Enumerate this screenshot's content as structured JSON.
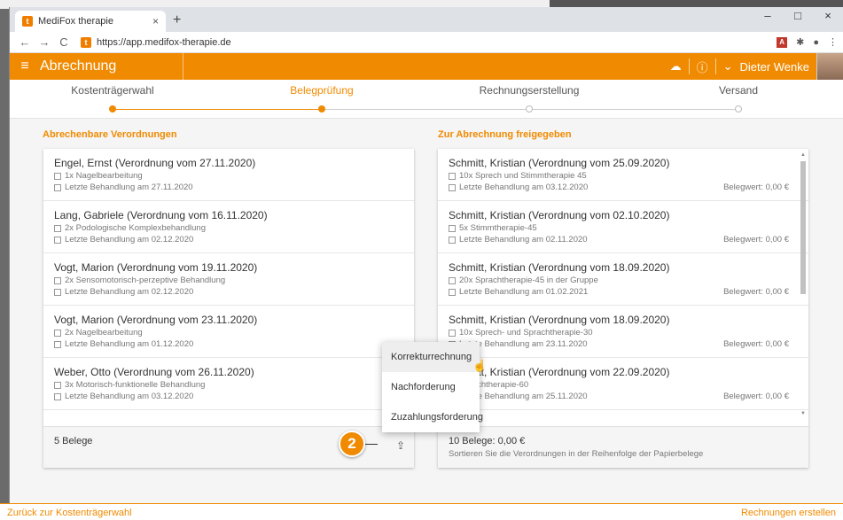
{
  "browser": {
    "tab_title": "MediFox therapie",
    "tab_close": "×",
    "new_tab": "+",
    "url": "https://app.medifox-therapie.de",
    "win_min": "–",
    "win_max": "□",
    "win_close": "×"
  },
  "app": {
    "title": "Abrechnung",
    "user": "Dieter Wenke",
    "accent": "#f08a00"
  },
  "steps": [
    {
      "label": "Kostenträgerwahl"
    },
    {
      "label": "Belegprüfung"
    },
    {
      "label": "Rechnungserstellung"
    },
    {
      "label": "Versand"
    }
  ],
  "left": {
    "title": "Abrechenbare Verordnungen",
    "items": [
      {
        "title": "Engel, Ernst (Verordnung vom 27.11.2020)",
        "line1": "1x Nagelbearbeitung",
        "line2": "Letzte Behandlung am 27.11.2020"
      },
      {
        "title": "Lang, Gabriele (Verordnung vom 16.11.2020)",
        "line1": "2x Podologische Komplexbehandlung",
        "line2": "Letzte Behandlung am 02.12.2020"
      },
      {
        "title": "Vogt, Marion (Verordnung vom 19.11.2020)",
        "line1": "2x Sensomotorisch-perzeptive Behandlung",
        "line2": "Letzte Behandlung am 02.12.2020"
      },
      {
        "title": "Vogt, Marion (Verordnung vom 23.11.2020)",
        "line1": "2x Nagelbearbeitung",
        "line2": "Letzte Behandlung am 01.12.2020"
      },
      {
        "title": "Weber, Otto (Verordnung vom 26.11.2020)",
        "line1": "3x Motorisch-funktionelle Behandlung",
        "line2": "Letzte Behandlung am 03.12.2020"
      }
    ],
    "footer": "5 Belege"
  },
  "right": {
    "title": "Zur Abrechnung freigegeben",
    "items": [
      {
        "title": "Schmitt, Kristian (Verordnung vom 25.09.2020)",
        "line1": "10x Sprech  und Stimmtherapie 45",
        "line2": "Letzte Behandlung am 03.12.2020",
        "value": "Belegwert: 0,00 €"
      },
      {
        "title": "Schmitt, Kristian (Verordnung vom 02.10.2020)",
        "line1": "5x Stimmtherapie-45",
        "line2": "Letzte Behandlung am 02.11.2020",
        "value": "Belegwert: 0,00 €"
      },
      {
        "title": "Schmitt, Kristian (Verordnung vom 18.09.2020)",
        "line1": "20x Sprachtherapie-45 in der Gruppe",
        "line2": "Letzte Behandlung am 01.02.2021",
        "value": "Belegwert: 0,00 €"
      },
      {
        "title": "Schmitt, Kristian (Verordnung vom 18.09.2020)",
        "line1": "10x Sprech- und Sprachtherapie-30",
        "line2": "Letzte Behandlung am 23.11.2020",
        "value": "Belegwert: 0,00 €"
      },
      {
        "title": "Schmitt, Kristian (Verordnung vom 22.09.2020)",
        "line1": "Sprachtherapie-60",
        "line2": "Letzte Behandlung am 25.11.2020",
        "value": "Belegwert: 0,00 €"
      }
    ],
    "footer": "10 Belege: 0,00 €",
    "footer_sub": "Sortieren Sie die Verordnungen in der Reihenfolge der Papierbelege"
  },
  "menu": [
    "Korrekturrechnung",
    "Nachforderung",
    "Zuzahlungsforderung"
  ],
  "callout": "2",
  "bottom": {
    "back": "Zurück zur Kostenträgerwahl",
    "next": "Rechnungen erstellen"
  }
}
